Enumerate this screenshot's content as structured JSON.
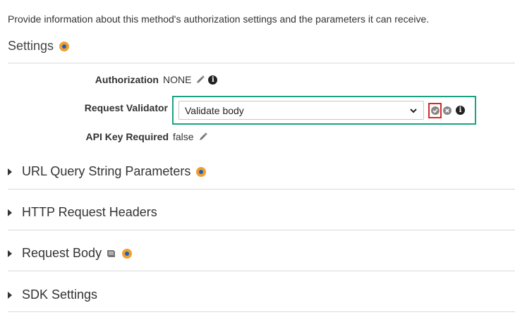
{
  "intro_text": "Provide information about this method's authorization settings and the parameters it can receive.",
  "settings": {
    "title": "Settings",
    "authorization": {
      "label": "Authorization",
      "value": "NONE"
    },
    "request_validator": {
      "label": "Request Validator",
      "selected": "Validate body"
    },
    "api_key": {
      "label": "API Key Required",
      "value": "false"
    }
  },
  "sections": [
    {
      "title": "URL Query String Parameters"
    },
    {
      "title": "HTTP Request Headers"
    },
    {
      "title": "Request Body"
    },
    {
      "title": "SDK Settings"
    }
  ],
  "colors": {
    "validator_border": "#1aa382",
    "highlight_border": "#d42a2a",
    "accent": "#f0a030"
  }
}
